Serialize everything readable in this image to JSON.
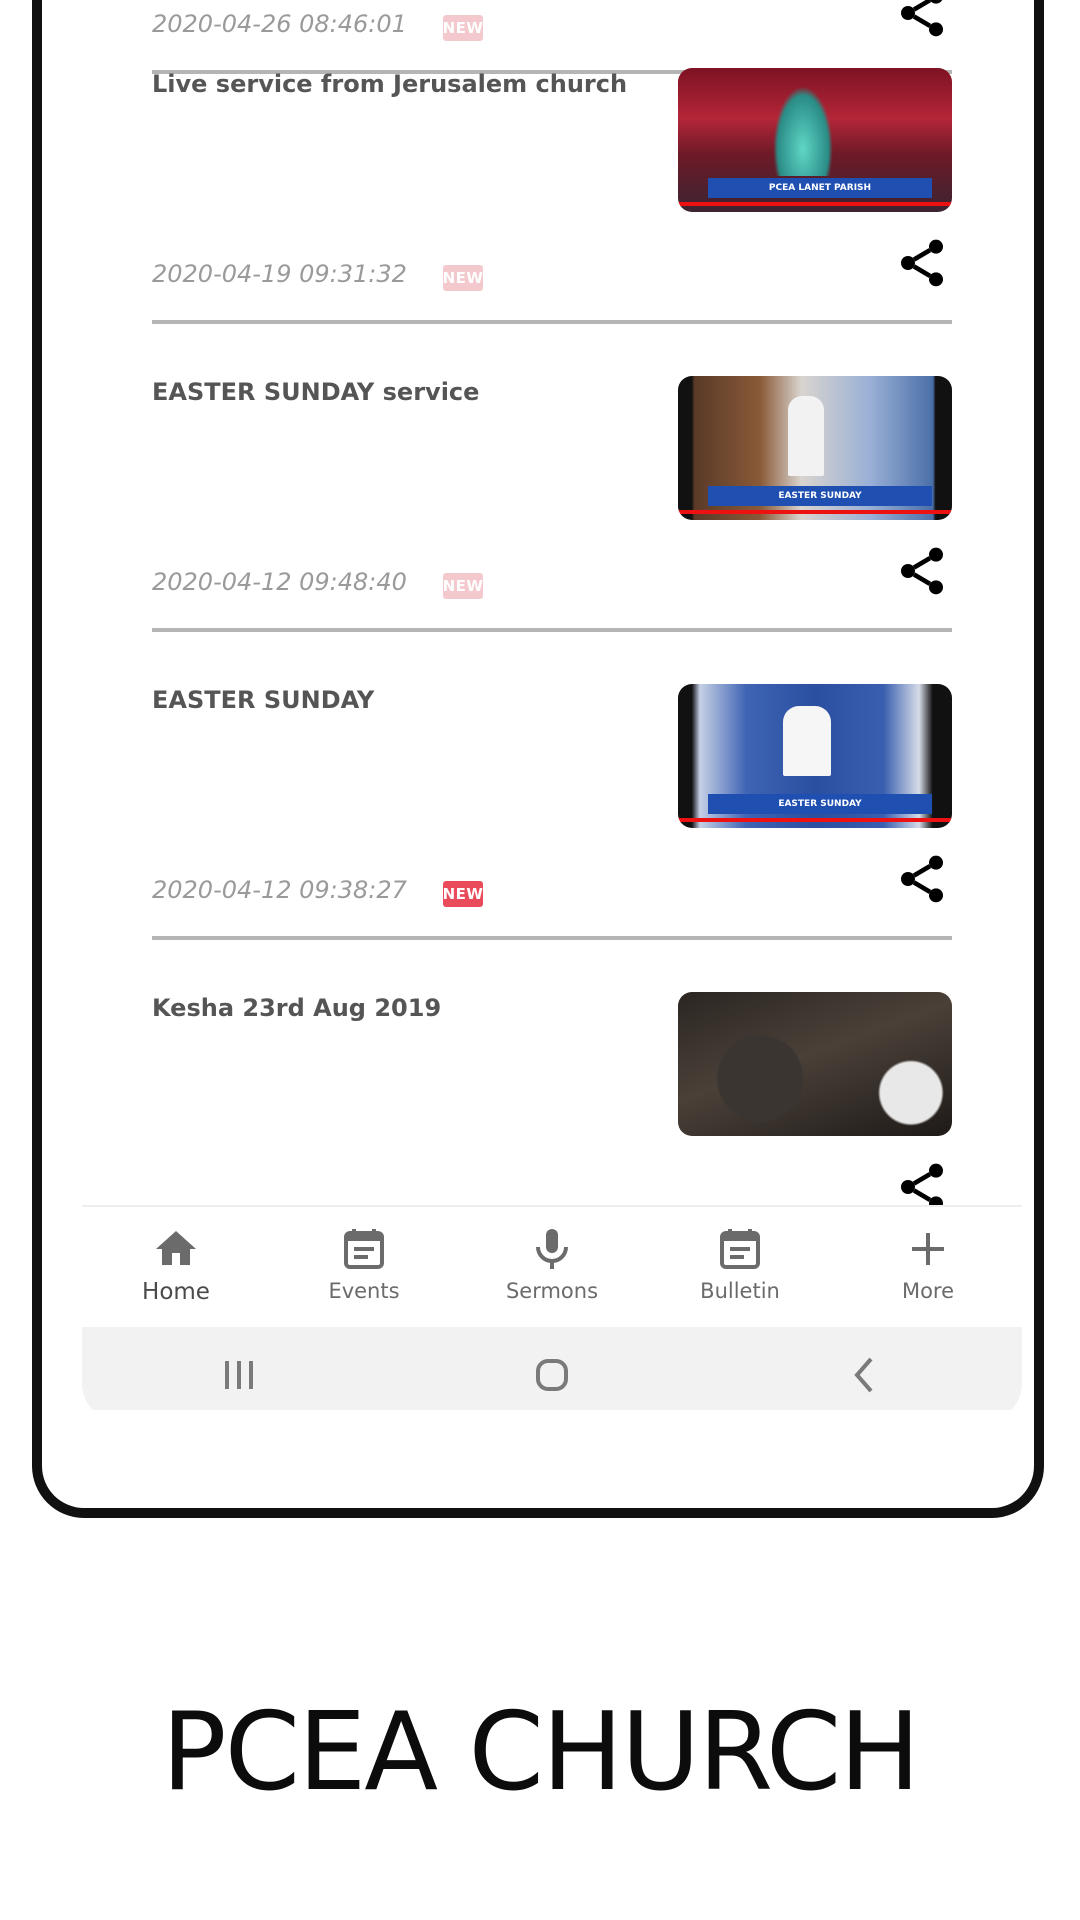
{
  "colors": {
    "new_badge_active": "#e94b5a",
    "new_badge_faded": "#f4c9cd",
    "title_text": "#555555",
    "date_text": "#9a9a9a",
    "divider": "#b5b5b5",
    "nav_icon": "#6b6b6b"
  },
  "feed": {
    "items": [
      {
        "title": "",
        "date": "2020-04-26 08:46:01",
        "badge": "NEW",
        "badge_style": "faded",
        "thumbnail": "church-service-thumbnail",
        "thumb_caption": ""
      },
      {
        "title": "Live service from Jerusalem church",
        "date": "2020-04-19 09:31:32",
        "badge": "NEW",
        "badge_style": "faded",
        "thumbnail": "choir-altar-thumbnail",
        "thumb_caption": "PCEA LANET PARISH"
      },
      {
        "title": "EASTER SUNDAY service",
        "date": "2020-04-12 09:48:40",
        "badge": "NEW",
        "badge_style": "faded",
        "thumbnail": "pulpit-easter-thumbnail",
        "thumb_caption": "EASTER SUNDAY"
      },
      {
        "title": "EASTER SUNDAY",
        "date": "2020-04-12 09:38:27",
        "badge": "NEW",
        "badge_style": "active",
        "thumbnail": "preacher-easter-thumbnail",
        "thumb_caption": "EASTER SUNDAY"
      },
      {
        "title": "Kesha 23rd Aug 2019",
        "date": "",
        "badge": "",
        "badge_style": "none",
        "thumbnail": "congregation-thumbnail",
        "thumb_caption": ""
      }
    ]
  },
  "bottom_nav": {
    "items": [
      {
        "label": "Home",
        "icon": "home-icon",
        "active": true
      },
      {
        "label": "Events",
        "icon": "calendar-icon",
        "active": false
      },
      {
        "label": "Sermons",
        "icon": "microphone-icon",
        "active": false
      },
      {
        "label": "Bulletin",
        "icon": "bulletin-icon",
        "active": false
      },
      {
        "label": "More",
        "icon": "plus-icon",
        "active": false
      }
    ]
  },
  "system_nav": {
    "buttons": [
      "recents-icon",
      "home-circle-icon",
      "back-icon"
    ]
  },
  "caption": {
    "text": "PCEA CHURCH"
  }
}
